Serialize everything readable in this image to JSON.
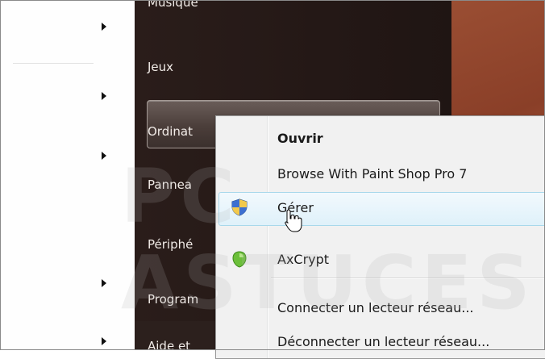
{
  "start_menu": {
    "right_items": [
      {
        "label": "Musique"
      },
      {
        "label": "Jeux"
      },
      {
        "label": "Ordinat"
      },
      {
        "label": "Pannea"
      },
      {
        "label": "Périphé"
      },
      {
        "label": "Program"
      },
      {
        "label": "Aide et"
      }
    ]
  },
  "context_menu": {
    "items": [
      {
        "label": "Ouvrir"
      },
      {
        "label": "Browse With Paint Shop Pro 7"
      },
      {
        "label": "Gérer",
        "icon": "uac-shield-icon"
      },
      {
        "label": "AxCrypt",
        "icon": "axcrypt-icon"
      },
      {
        "label": "Connecter un lecteur réseau..."
      },
      {
        "label": "Déconnecter un lecteur réseau..."
      }
    ]
  },
  "watermark": {
    "text": "PC ASTUCES"
  },
  "colors": {
    "menu_bg": "#f1f1f1",
    "hover_bg": "#dff1fa",
    "start_right_bg": "#2a1d1a",
    "wallpaper": "#9a4e33"
  }
}
